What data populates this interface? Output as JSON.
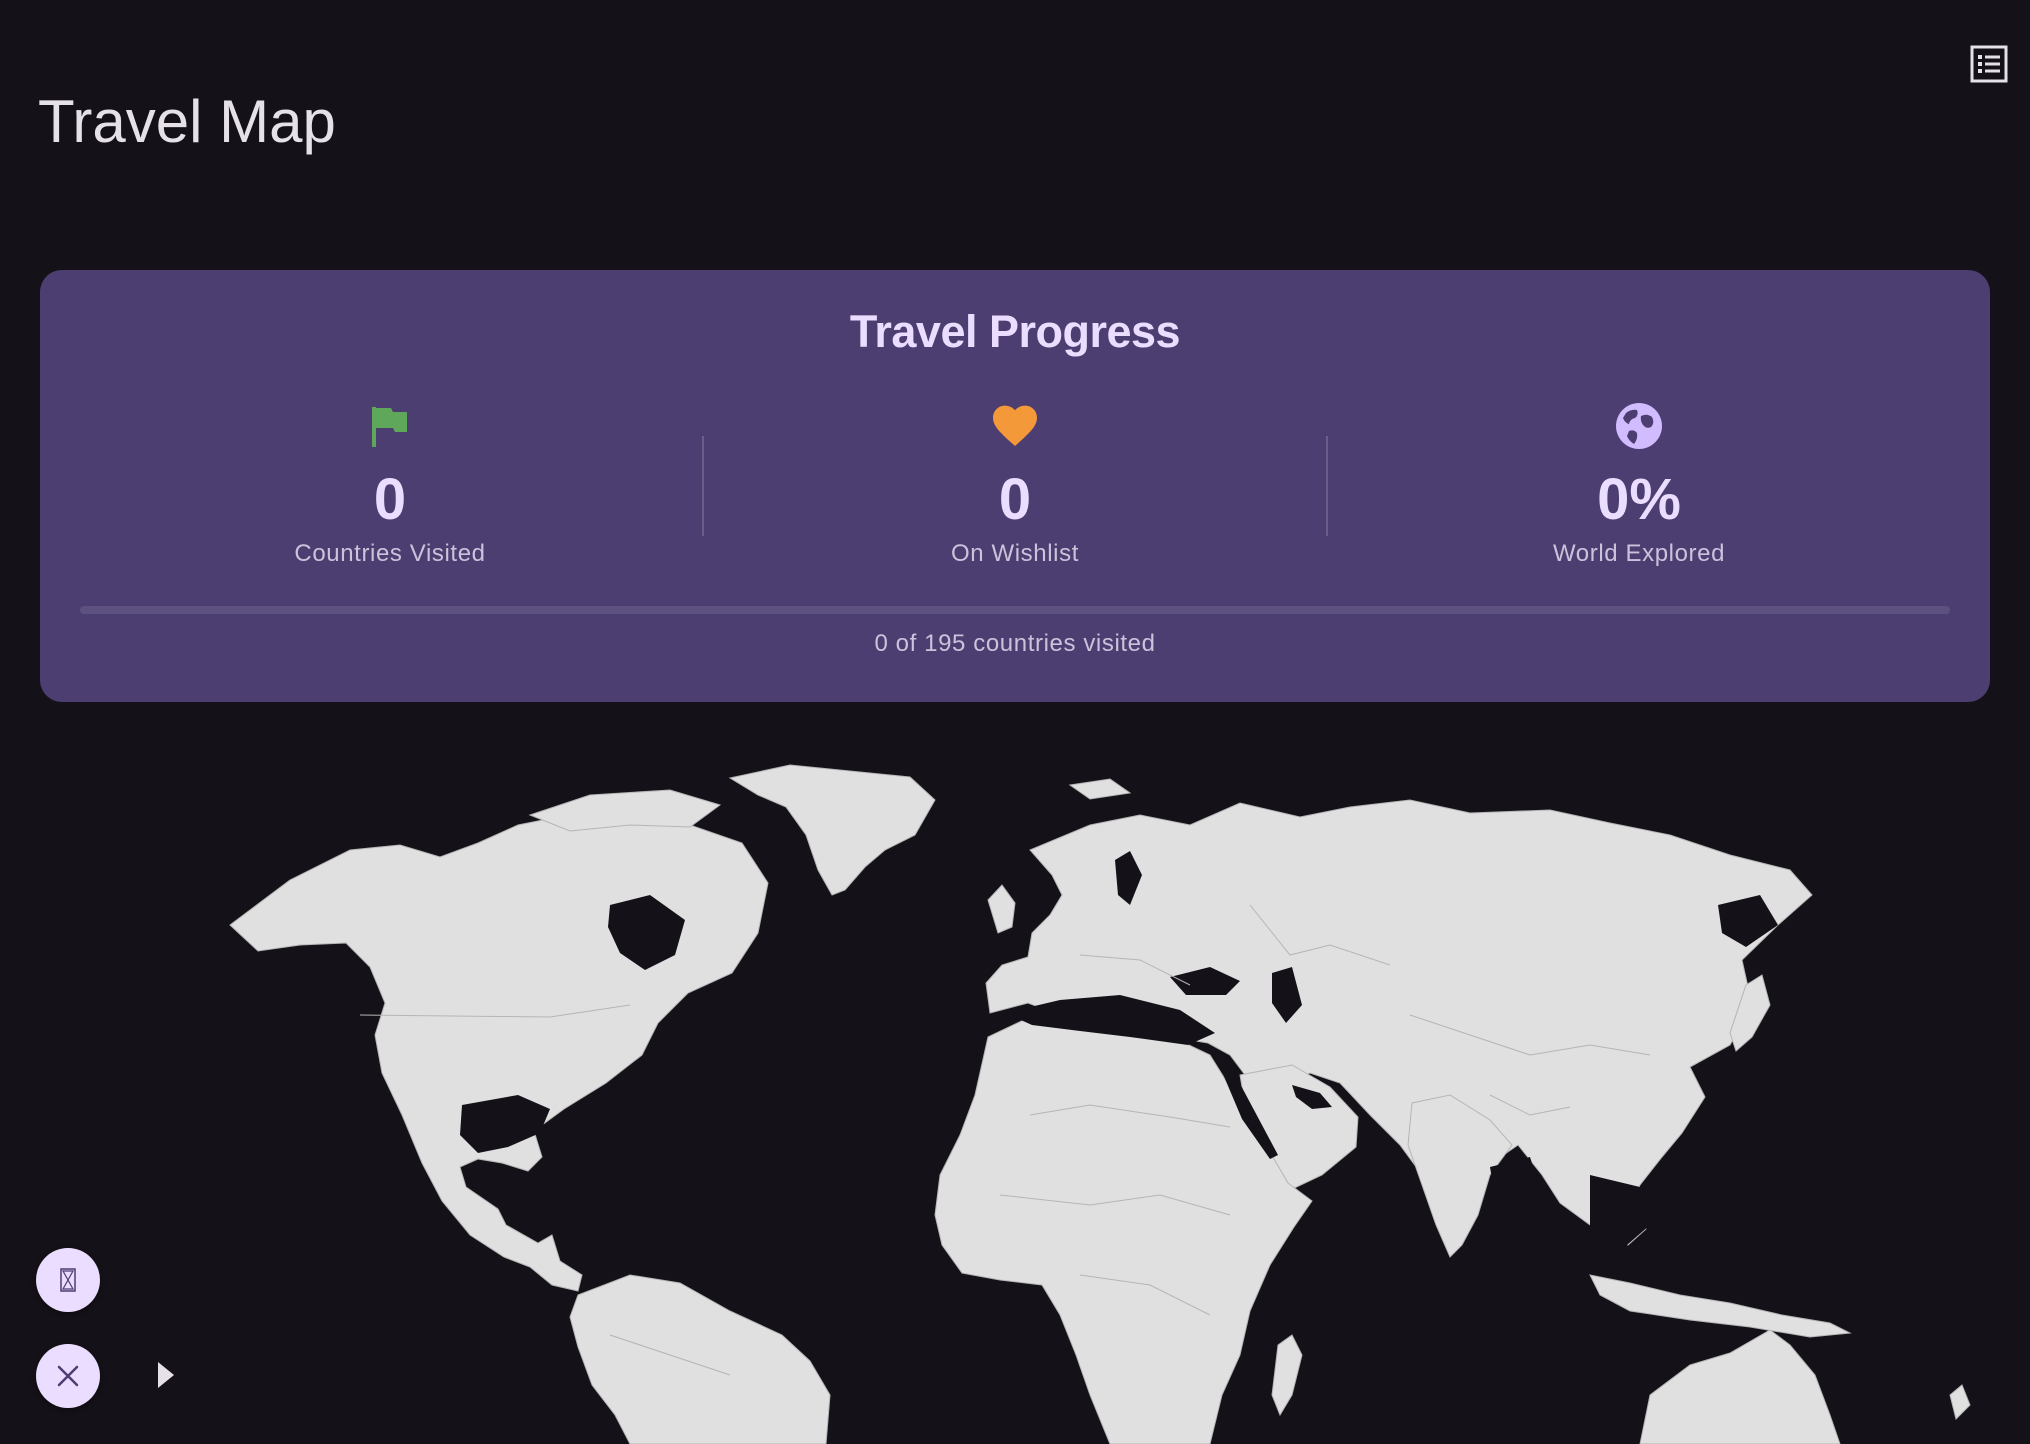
{
  "app": {
    "title": "Travel Map",
    "list_icon": "list-view-icon"
  },
  "progress": {
    "title": "Travel Progress",
    "stats": [
      {
        "icon": "flag-icon",
        "value": "0",
        "label": "Countries Visited",
        "color": "#5fa75b"
      },
      {
        "icon": "heart-icon",
        "value": "0",
        "label": "On Wishlist",
        "color": "#f3993a"
      },
      {
        "icon": "globe-icon",
        "value": "0%",
        "label": "World Explored",
        "color": "#d0bcff"
      }
    ],
    "visited_fraction": 0,
    "summary": "0 of 195 countries visited"
  },
  "map": {
    "land_color": "#e0e0e0",
    "ocean_color": "#141218"
  },
  "controls": {
    "top_fab_icon": "hourglass-icon",
    "bottom_fab_icon": "close-icon",
    "expand_icon": "play-arrow-icon"
  }
}
